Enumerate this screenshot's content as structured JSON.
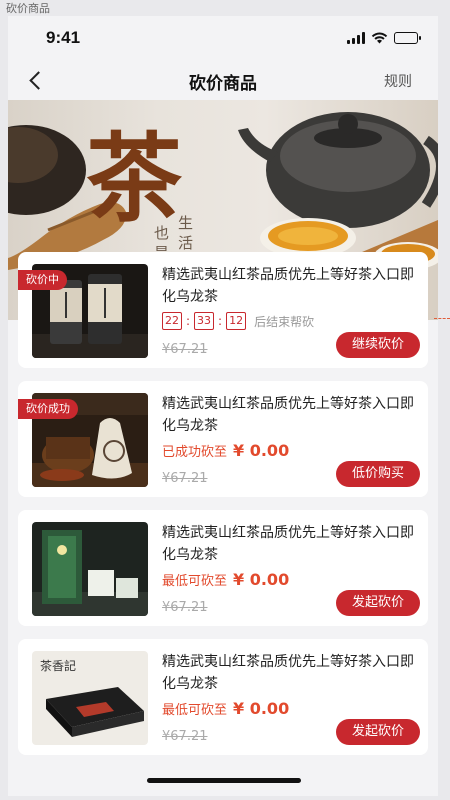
{
  "caption": "砍价商品",
  "status": {
    "time": "9:41"
  },
  "nav": {
    "title": "砍价商品",
    "rules": "规则"
  },
  "banner": {
    "calligraphy": "茶",
    "vertical_a": "也是",
    "vertical_b": "生活"
  },
  "products": [
    {
      "tag": "砍价中",
      "title": "精选武夷山红茶品质优先上等好茶入口即化乌龙茶",
      "timer": {
        "h": "22",
        "m": "33",
        "s": "12",
        "after": "后结束帮砍"
      },
      "original_price": "¥67.21",
      "action": "继续砍价"
    },
    {
      "tag": "砍价成功",
      "title": "精选武夷山红茶品质优先上等好茶入口即化乌龙茶",
      "price_label": "已成功砍至",
      "price": "¥ 0.00",
      "original_price": "¥67.21",
      "action": "低价购买"
    },
    {
      "title": "精选武夷山红茶品质优先上等好茶入口即化乌龙茶",
      "price_label": "最低可砍至",
      "price": "¥ 0.00",
      "original_price": "¥67.21",
      "action": "发起砍价"
    },
    {
      "title": "精选武夷山红茶品质优先上等好茶入口即化乌龙茶",
      "price_label": "最低可砍至",
      "price": "¥ 0.00",
      "original_price": "¥67.21",
      "action": "发起砍价",
      "thumb_text": "茶香記"
    }
  ],
  "colors": {
    "accent": "#c8282e",
    "price": "#e24a2d",
    "background": "#f3f3f5"
  },
  "icons": [
    "back-icon",
    "signal-icon",
    "wifi-icon",
    "battery-icon"
  ]
}
